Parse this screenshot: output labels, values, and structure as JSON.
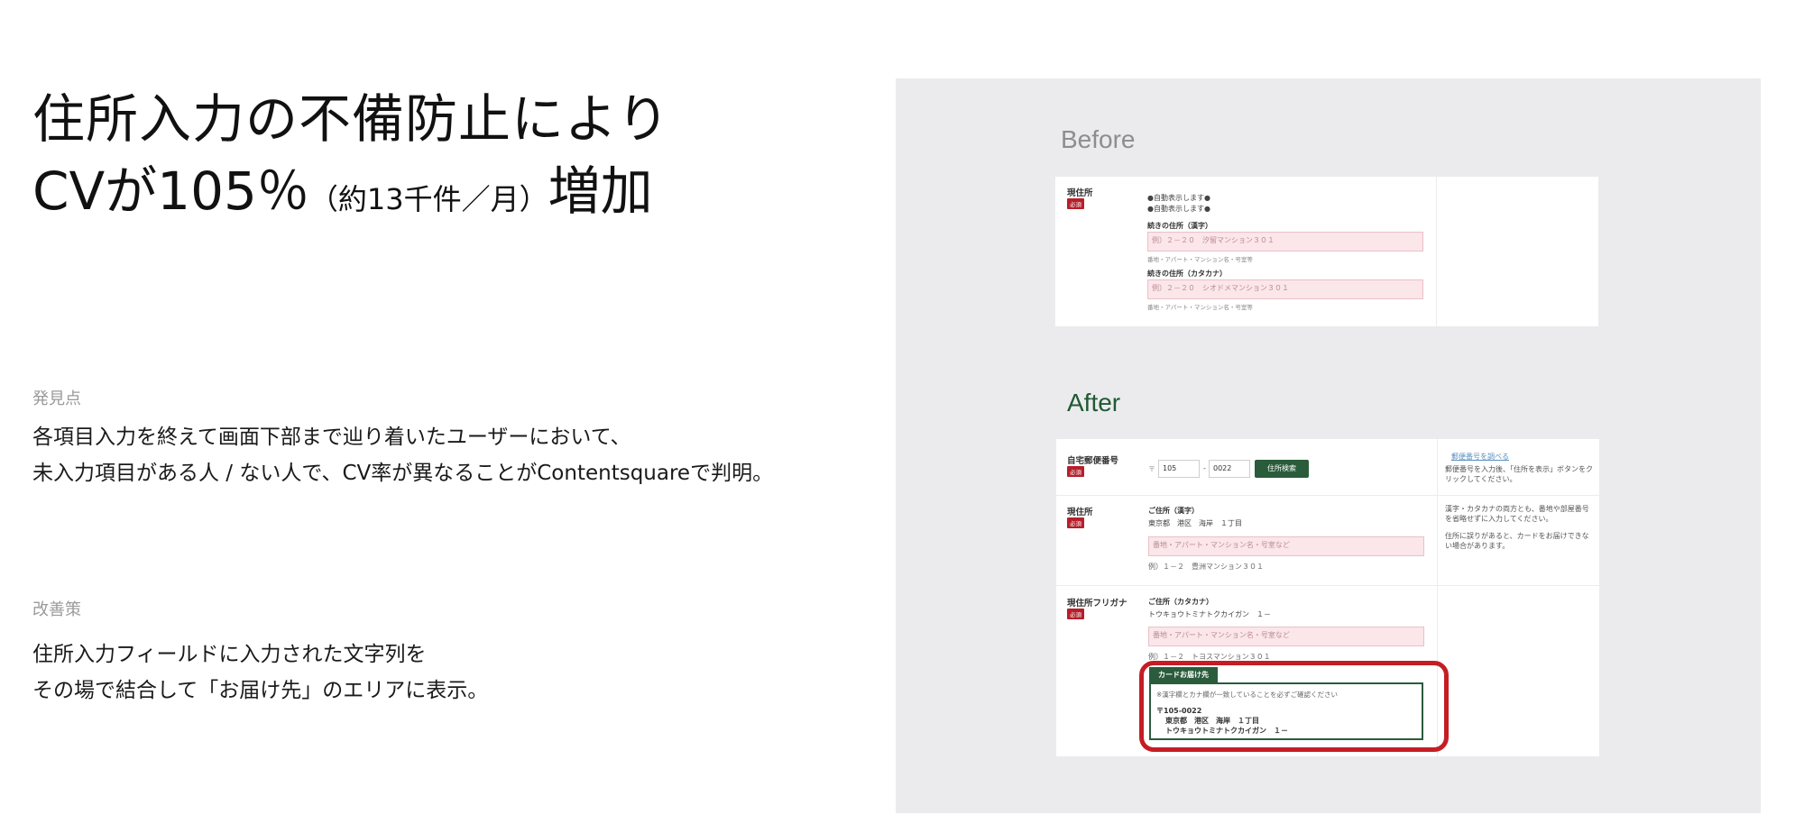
{
  "headline": {
    "line1": "住所入力の不備防止により",
    "line2_main": "CVが105％",
    "line2_note": "（約13千件／月）",
    "line2_end": "増加"
  },
  "finding": {
    "label": "発見点",
    "line1": "各項目入力を終えて画面下部まで辿り着いたユーザーにおいて、",
    "line2": "未入力項目がある人 / ない人で、CV率が異なることがContentsquareで判明。"
  },
  "improvement": {
    "label": "改善策",
    "line1": "住所入力フィールドに入力された文字列を",
    "line2": "その場で結合して「お届け先」のエリアに表示。"
  },
  "before": {
    "caption": "Before",
    "field_label": "現住所",
    "required": "必須",
    "auto1": "●自動表示します●",
    "auto2": "●自動表示します●",
    "kanji_label": "続きの住所（漢字）",
    "kanji_placeholder": "例）２－２０　汐留マンション３０１",
    "kanji_hint": "番地・アパート・マンション名・号室等",
    "kana_label": "続きの住所（カタカナ）",
    "kana_placeholder": "例）２－２０　シオドメマンション３０１",
    "kana_hint": "番地・アパート・マンション名・号室等"
  },
  "after": {
    "caption": "After",
    "zip_label": "自宅郵便番号",
    "required": "必須",
    "zip_mark": "〒",
    "zip1": "105",
    "zip_sep": "-",
    "zip2": "0022",
    "search_button": "住所検索",
    "zip_link": "郵便番号を調べる",
    "zip_note": "郵便番号を入力後、「住所を表示」ボタンをクリックしてください。",
    "addr_label": "現住所",
    "addr_heading": "ご住所（漢字）",
    "addr_value": "東京都　港区　海岸　１丁目",
    "addr_placeholder": "番地・アパート・マンション名・号室など",
    "addr_example": "例）１－２　豊洲マンション３０１",
    "addr_note1": "漢字・カタカナの両方とも、番地や部屋番号を省略せずに入力してください。",
    "addr_note2": "住所に誤りがあると、カードをお届けできない場合があります。",
    "kana_label": "現住所フリガナ",
    "kana_heading": "ご住所（カタカナ）",
    "kana_value": "トウキョウトミナトクカイガン　１－",
    "kana_placeholder": "番地・アパート・マンション名・号室など",
    "kana_example": "例）１－２　トヨスマンション３０１",
    "delivery_tab": "カードお届け先",
    "delivery_notice": "※漢字欄とカナ欄が一致していることを必ずご確認ください",
    "delivery_zip": "〒105-0022",
    "delivery_addr": "東京都　港区　海岸　１丁目",
    "delivery_kana": "トウキョウトミナトクカイガン　１－"
  },
  "colors": {
    "accent_green": "#2a5c3b",
    "highlight_red": "#c41e24",
    "required_red": "#b51f2b",
    "panel_gray": "#ebebee"
  }
}
